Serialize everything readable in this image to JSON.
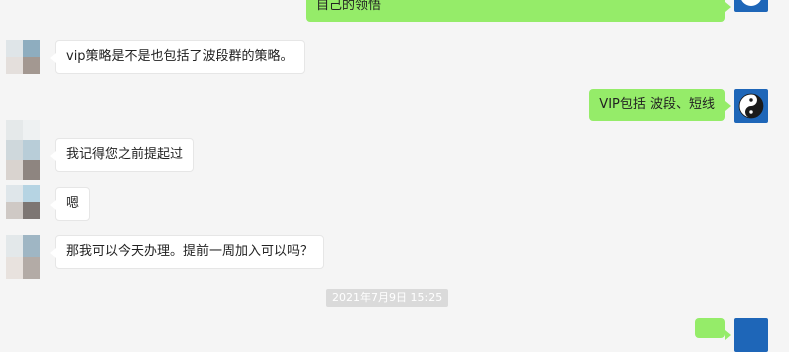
{
  "messages": [
    {
      "side": "right",
      "text": "自己的领悟"
    },
    {
      "side": "left",
      "text": "vip策略是不是也包括了波段群的策略。"
    },
    {
      "side": "right",
      "text": "VIP包括 波段、短线"
    },
    {
      "side": "left",
      "text": "我记得您之前提起过"
    },
    {
      "side": "left",
      "text": "嗯"
    },
    {
      "side": "left",
      "text": "那我可以今天办理。提前一周加入可以吗？"
    }
  ],
  "timestamp": "2021年7月9日  15:25",
  "icons": {
    "self_avatar": "yin-yang-icon",
    "contact_avatar": "blurred-avatar"
  },
  "colors": {
    "background": "#f5f5f5",
    "bubble_self": "#95ec69",
    "bubble_other": "#ffffff",
    "self_avatar_bg": "#1e66b8",
    "timestamp_bg": "#dadada"
  }
}
